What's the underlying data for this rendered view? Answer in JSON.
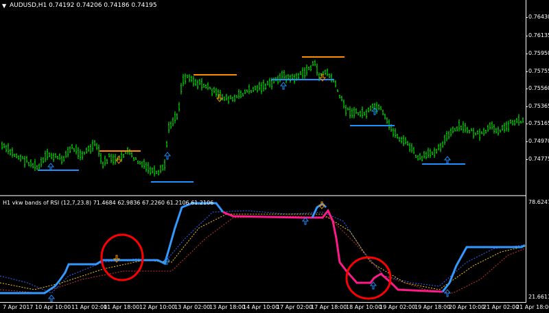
{
  "main_chart": {
    "symbol_line": "AUDUSD,H1  0.74192 0.74206 0.74186 0.74195",
    "dropdown_icon": "triangle-down-icon",
    "price_labels": [
      "0.76430",
      "0.76135",
      "0.75950",
      "0.75755",
      "0.75560",
      "0.75365",
      "0.75165",
      "0.74970",
      "0.74775"
    ],
    "colors": {
      "bars": "#00ff00",
      "resistance": "#ff8c00",
      "support": "#1e90ff",
      "arrows": "#1e90ff"
    }
  },
  "indicator": {
    "title": "H1 vkw bands of RSI (12,7,23.8) 71.4684 62.9836 67.2260 61.2106 61.2106",
    "top_value": "78.6247",
    "bottom_value": "21.6611",
    "colors": {
      "up_line": "#3399ff",
      "down_line": "#ff1a8c",
      "dotted": [
        "#3366ff",
        "#ffcc00",
        "#cc3333"
      ],
      "circle": "#ff0000"
    }
  },
  "time_axis": [
    "7 Apr 2017",
    "10 Apr 10:00",
    "11 Apr 02:00",
    "11 Apr 18:00",
    "12 Apr 10:00",
    "13 Apr 02:00",
    "13 Apr 18:00",
    "14 Apr 10:00",
    "17 Apr 02:00",
    "17 Apr 18:00",
    "18 Apr 10:00",
    "19 Apr 02:00",
    "19 Apr 18:00",
    "20 Apr 10:00",
    "21 Apr 02:00",
    "21 Apr 18:00"
  ]
}
